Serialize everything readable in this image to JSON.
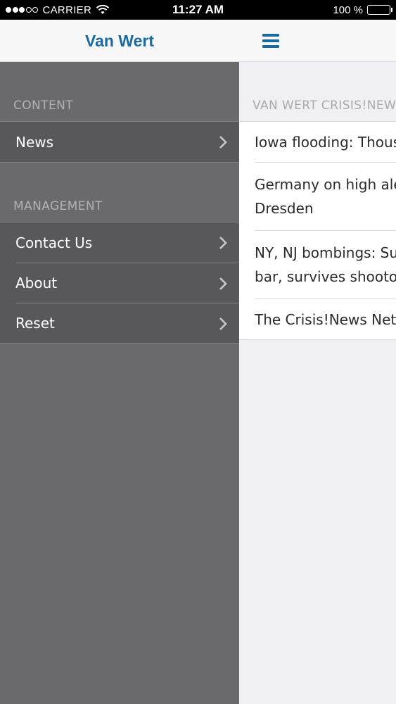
{
  "status_bar": {
    "carrier": "CARRIER",
    "time": "11:27 AM",
    "battery": "100 %",
    "signal_bars_filled": 3,
    "signal_bars_total": 5
  },
  "nav": {
    "title": "Van Wert",
    "menu_icon": "hamburger-menu-icon",
    "accent_color": "#1a6aa0"
  },
  "sidebar": {
    "sections": [
      {
        "header": "CONTENT",
        "items": [
          {
            "label": "News",
            "icon": "chevron-right-icon"
          }
        ]
      },
      {
        "header": "MANAGEMENT",
        "items": [
          {
            "label": "Contact Us",
            "icon": "chevron-right-icon"
          },
          {
            "label": "About",
            "icon": "chevron-right-icon"
          },
          {
            "label": "Reset",
            "icon": "chevron-right-icon"
          }
        ]
      }
    ]
  },
  "content": {
    "header": "VAN WERT CRISIS!NEWS",
    "news": [
      {
        "line1": "Iowa flooding: Thousands",
        "line2": ""
      },
      {
        "line1": "Germany on high alert in",
        "line2": "Dresden"
      },
      {
        "line1": "NY, NJ bombings: Suspect",
        "line2": "bar, survives shootout"
      },
      {
        "line1": "The Crisis!News Network",
        "line2": ""
      }
    ]
  }
}
